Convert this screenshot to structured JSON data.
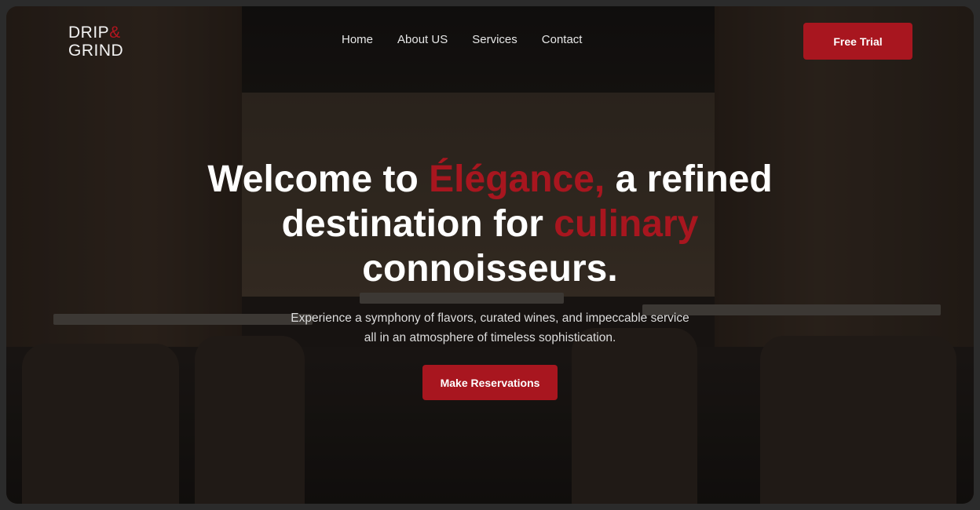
{
  "brand": {
    "line1": "DRIP",
    "amp": "&",
    "line2": "GRIND"
  },
  "nav": {
    "items": [
      "Home",
      "About US",
      "Services",
      "Contact"
    ],
    "cta_label": "Free Trial"
  },
  "hero": {
    "title_parts": [
      {
        "text": "Welcome to ",
        "accent": false
      },
      {
        "text": "Élégance,",
        "accent": true
      },
      {
        "text": " a refined destination for ",
        "accent": false
      },
      {
        "text": "culinary",
        "accent": true
      },
      {
        "text": " connoisseurs.",
        "accent": false
      }
    ],
    "subtitle": "Experience a symphony of flavors, curated wines, and impeccable service all in an atmosphere of timeless sophistication.",
    "cta_label": "Make Reservations"
  },
  "colors": {
    "accent": "#a8161f",
    "text": "#ffffff",
    "frame": "#2b2b2b"
  }
}
